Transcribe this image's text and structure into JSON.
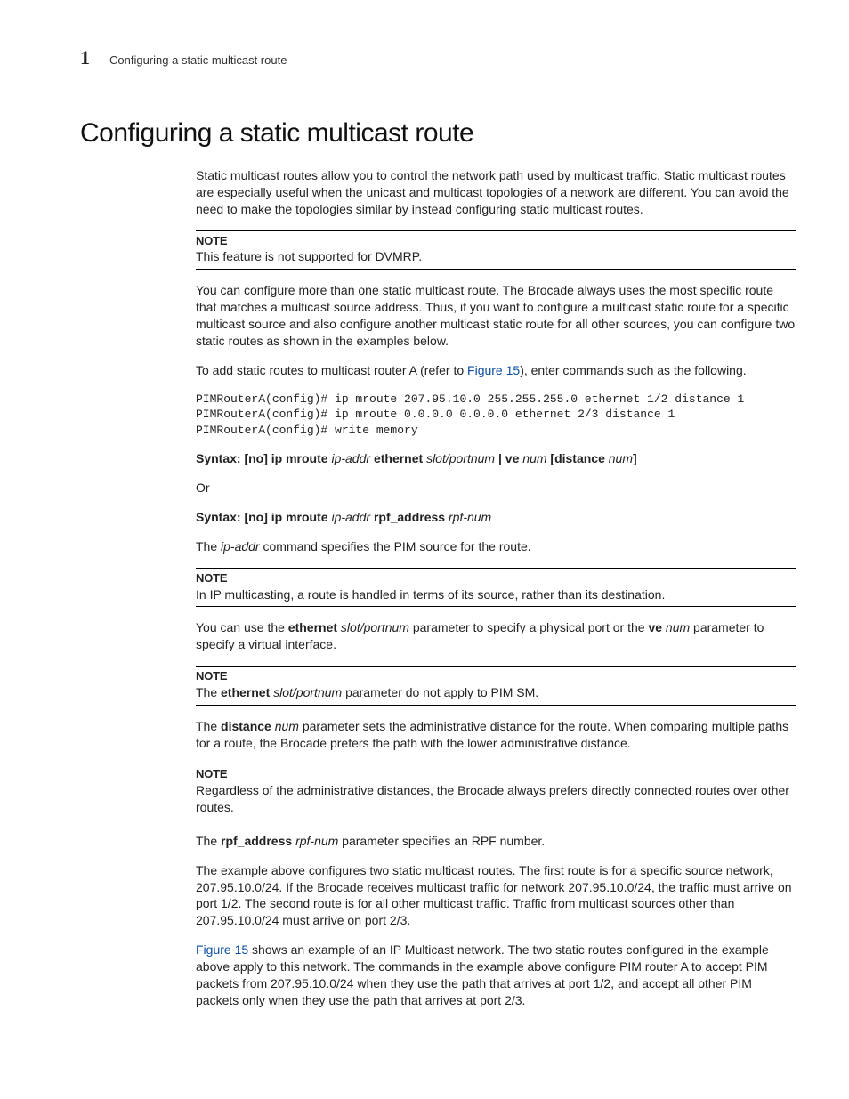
{
  "header": {
    "chapter_number": "1",
    "running_title": "Configuring a static multicast route"
  },
  "title": "Configuring a static multicast route",
  "labels": {
    "note": "NOTE"
  },
  "links": {
    "figure_15": "Figure 15"
  },
  "paragraphs": {
    "intro": "Static multicast routes allow you to control the network path used by multicast traffic. Static multicast routes are especially useful when the unicast and multicast topologies of a network are different. You can avoid the need to make the topologies similar by instead configuring static multicast routes.",
    "p2": "You can configure more than one static multicast route. The Brocade always uses the most specific route that matches a multicast source address. Thus, if you want to configure a multicast static route for a specific multicast source and also configure another multicast static route for all other sources, you can configure two static routes as shown in the examples below.",
    "p3_before": "To add static routes to multicast router A (refer to ",
    "p3_after": "), enter commands such as the following.",
    "or": "Or",
    "p4a": "The ",
    "p4b": "ip-addr",
    "p4c": " command specifies the PIM source for the route.",
    "p5a": "You can use the ",
    "p5b": "ethernet ",
    "p5c": "slot/portnum",
    "p5d": "  parameter to specify a physical port or the ",
    "p5e": "ve ",
    "p5f": "num",
    "p5g": " parameter to specify a virtual interface.",
    "p6a": "The ",
    "p6b": "distance ",
    "p6c": "num",
    "p6d": " parameter sets the administrative distance for the route. When comparing multiple paths for a route, the Brocade prefers the path with the lower administrative distance.",
    "p7a": "The ",
    "p7b": "rpf_address ",
    "p7c": "rpf-num",
    "p7d": " parameter specifies an RPF number.",
    "p8": "The example above configures two static multicast routes. The first route is for a specific source network, 207.95.10.0/24. If the Brocade receives multicast traffic for network 207.95.10.0/24, the traffic must arrive on port 1/2. The second route is for all other multicast traffic. Traffic from multicast sources other than 207.95.10.0/24 must arrive on port 2/3.",
    "p9": " shows an example of an IP Multicast network. The two static routes configured in the example above apply to this network. The commands in the example above configure PIM router A to accept PIM packets from 207.95.10.0/24 when they use the path that arrives at port 1/2, and accept all other PIM packets only when they use the path that arrives at port 2/3."
  },
  "notes": {
    "n1": "This feature is not supported for DVMRP.",
    "n2": "In IP multicasting, a route is handled in terms of its source, rather than its destination.",
    "n3a": "The ",
    "n3b": "ethernet ",
    "n3c": "slot/portnum",
    "n3d": " parameter do not apply to PIM SM.",
    "n4": "Regardless of the administrative distances, the Brocade always prefers directly connected routes over other routes."
  },
  "code_block": "PIMRouterA(config)# ip mroute 207.95.10.0 255.255.255.0 ethernet 1/2 distance 1\nPIMRouterA(config)# ip mroute 0.0.0.0 0.0.0.0 ethernet 2/3 distance 1\nPIMRouterA(config)# write memory",
  "syntax": {
    "s1": {
      "a": "Syntax:  [no] ip mroute",
      "b": " ip-addr",
      "c": " ethernet",
      "d": " slot/portnum",
      "e": " | ve",
      "f": " num",
      "g": " [distance",
      "h": " num",
      "i": "]"
    },
    "s2": {
      "a": "Syntax:  [no] ip mroute",
      "b": " ip-addr",
      "c": " rpf_address",
      "d": " rpf-num"
    }
  }
}
